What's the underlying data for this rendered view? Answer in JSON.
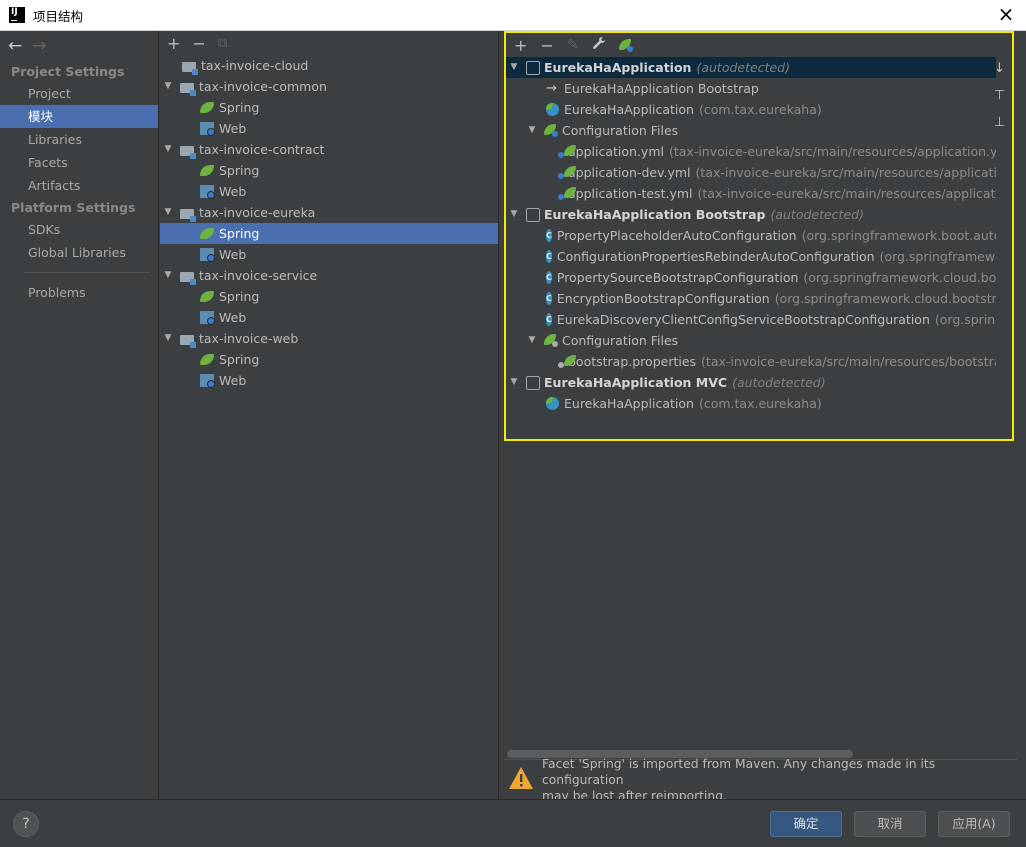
{
  "window": {
    "title": "项目结构",
    "close": "×"
  },
  "nav": {
    "back": "←",
    "forward": "→",
    "project_settings": "Project Settings",
    "project_items": [
      "Project",
      "模块",
      "Libraries",
      "Facets",
      "Artifacts"
    ],
    "platform_settings": "Platform Settings",
    "platform_items": [
      "SDKs",
      "Global Libraries"
    ],
    "problems": "Problems"
  },
  "modules": {
    "toolbar": {
      "add": "+",
      "remove": "−",
      "copy": "⧉"
    },
    "tree": [
      {
        "name": "tax-invoice-cloud",
        "children": []
      },
      {
        "name": "tax-invoice-common",
        "children": [
          "Spring",
          "Web"
        ]
      },
      {
        "name": "tax-invoice-contract",
        "children": [
          "Spring",
          "Web"
        ]
      },
      {
        "name": "tax-invoice-eureka",
        "children": [
          "Spring",
          "Web"
        ]
      },
      {
        "name": "tax-invoice-service",
        "children": [
          "Spring",
          "Web"
        ]
      },
      {
        "name": "tax-invoice-web",
        "children": [
          "Spring",
          "Web"
        ]
      }
    ]
  },
  "spring": {
    "toolbar": {
      "add": "+",
      "remove": "−",
      "edit": "✎",
      "wrench": "🔧"
    },
    "ctx1": {
      "name": "EurekaHaApplication",
      "tag": "(autodetected)"
    },
    "ctx1_parent": "EurekaHaApplication Bootstrap",
    "ctx1_app": {
      "name": "EurekaHaApplication",
      "pkg": "(com.tax.eurekaha)"
    },
    "ctx1_cfg": "Configuration Files",
    "ctx1_files": [
      {
        "name": "application.yml",
        "path": "(tax-invoice-eureka/src/main/resources/application.yml)"
      },
      {
        "name": "application-dev.yml",
        "path": "(tax-invoice-eureka/src/main/resources/application"
      },
      {
        "name": "application-test.yml",
        "path": "(tax-invoice-eureka/src/main/resources/application"
      }
    ],
    "ctx2": {
      "name": "EurekaHaApplication Bootstrap",
      "tag": "(autodetected)"
    },
    "ctx2_classes": [
      {
        "name": "PropertyPlaceholderAutoConfiguration",
        "pkg": "(org.springframework.boot.autoco"
      },
      {
        "name": "ConfigurationPropertiesRebinderAutoConfiguration",
        "pkg": "(org.springframework."
      },
      {
        "name": "PropertySourceBootstrapConfiguration",
        "pkg": "(org.springframework.cloud.boots"
      },
      {
        "name": "EncryptionBootstrapConfiguration",
        "pkg": "(org.springframework.cloud.bootstrap.e"
      },
      {
        "name": "EurekaDiscoveryClientConfigServiceBootstrapConfiguration",
        "pkg": "(org.springfra"
      }
    ],
    "ctx2_cfg": "Configuration Files",
    "ctx2_files": [
      {
        "name": "bootstrap.properties",
        "path": "(tax-invoice-eureka/src/main/resources/bootstrap"
      }
    ],
    "ctx3": {
      "name": "EurekaHaApplication MVC",
      "tag": "(autodetected)"
    },
    "ctx3_app": {
      "name": "EurekaHaApplication",
      "pkg": "(com.tax.eurekaha)"
    }
  },
  "warning": {
    "line1": "Facet 'Spring' is imported from Maven. Any changes made in its configuration",
    "line2": "may be lost after reimporting."
  },
  "buttons": {
    "help": "?",
    "ok": "确定",
    "cancel": "取消",
    "apply": "应用(A)"
  }
}
